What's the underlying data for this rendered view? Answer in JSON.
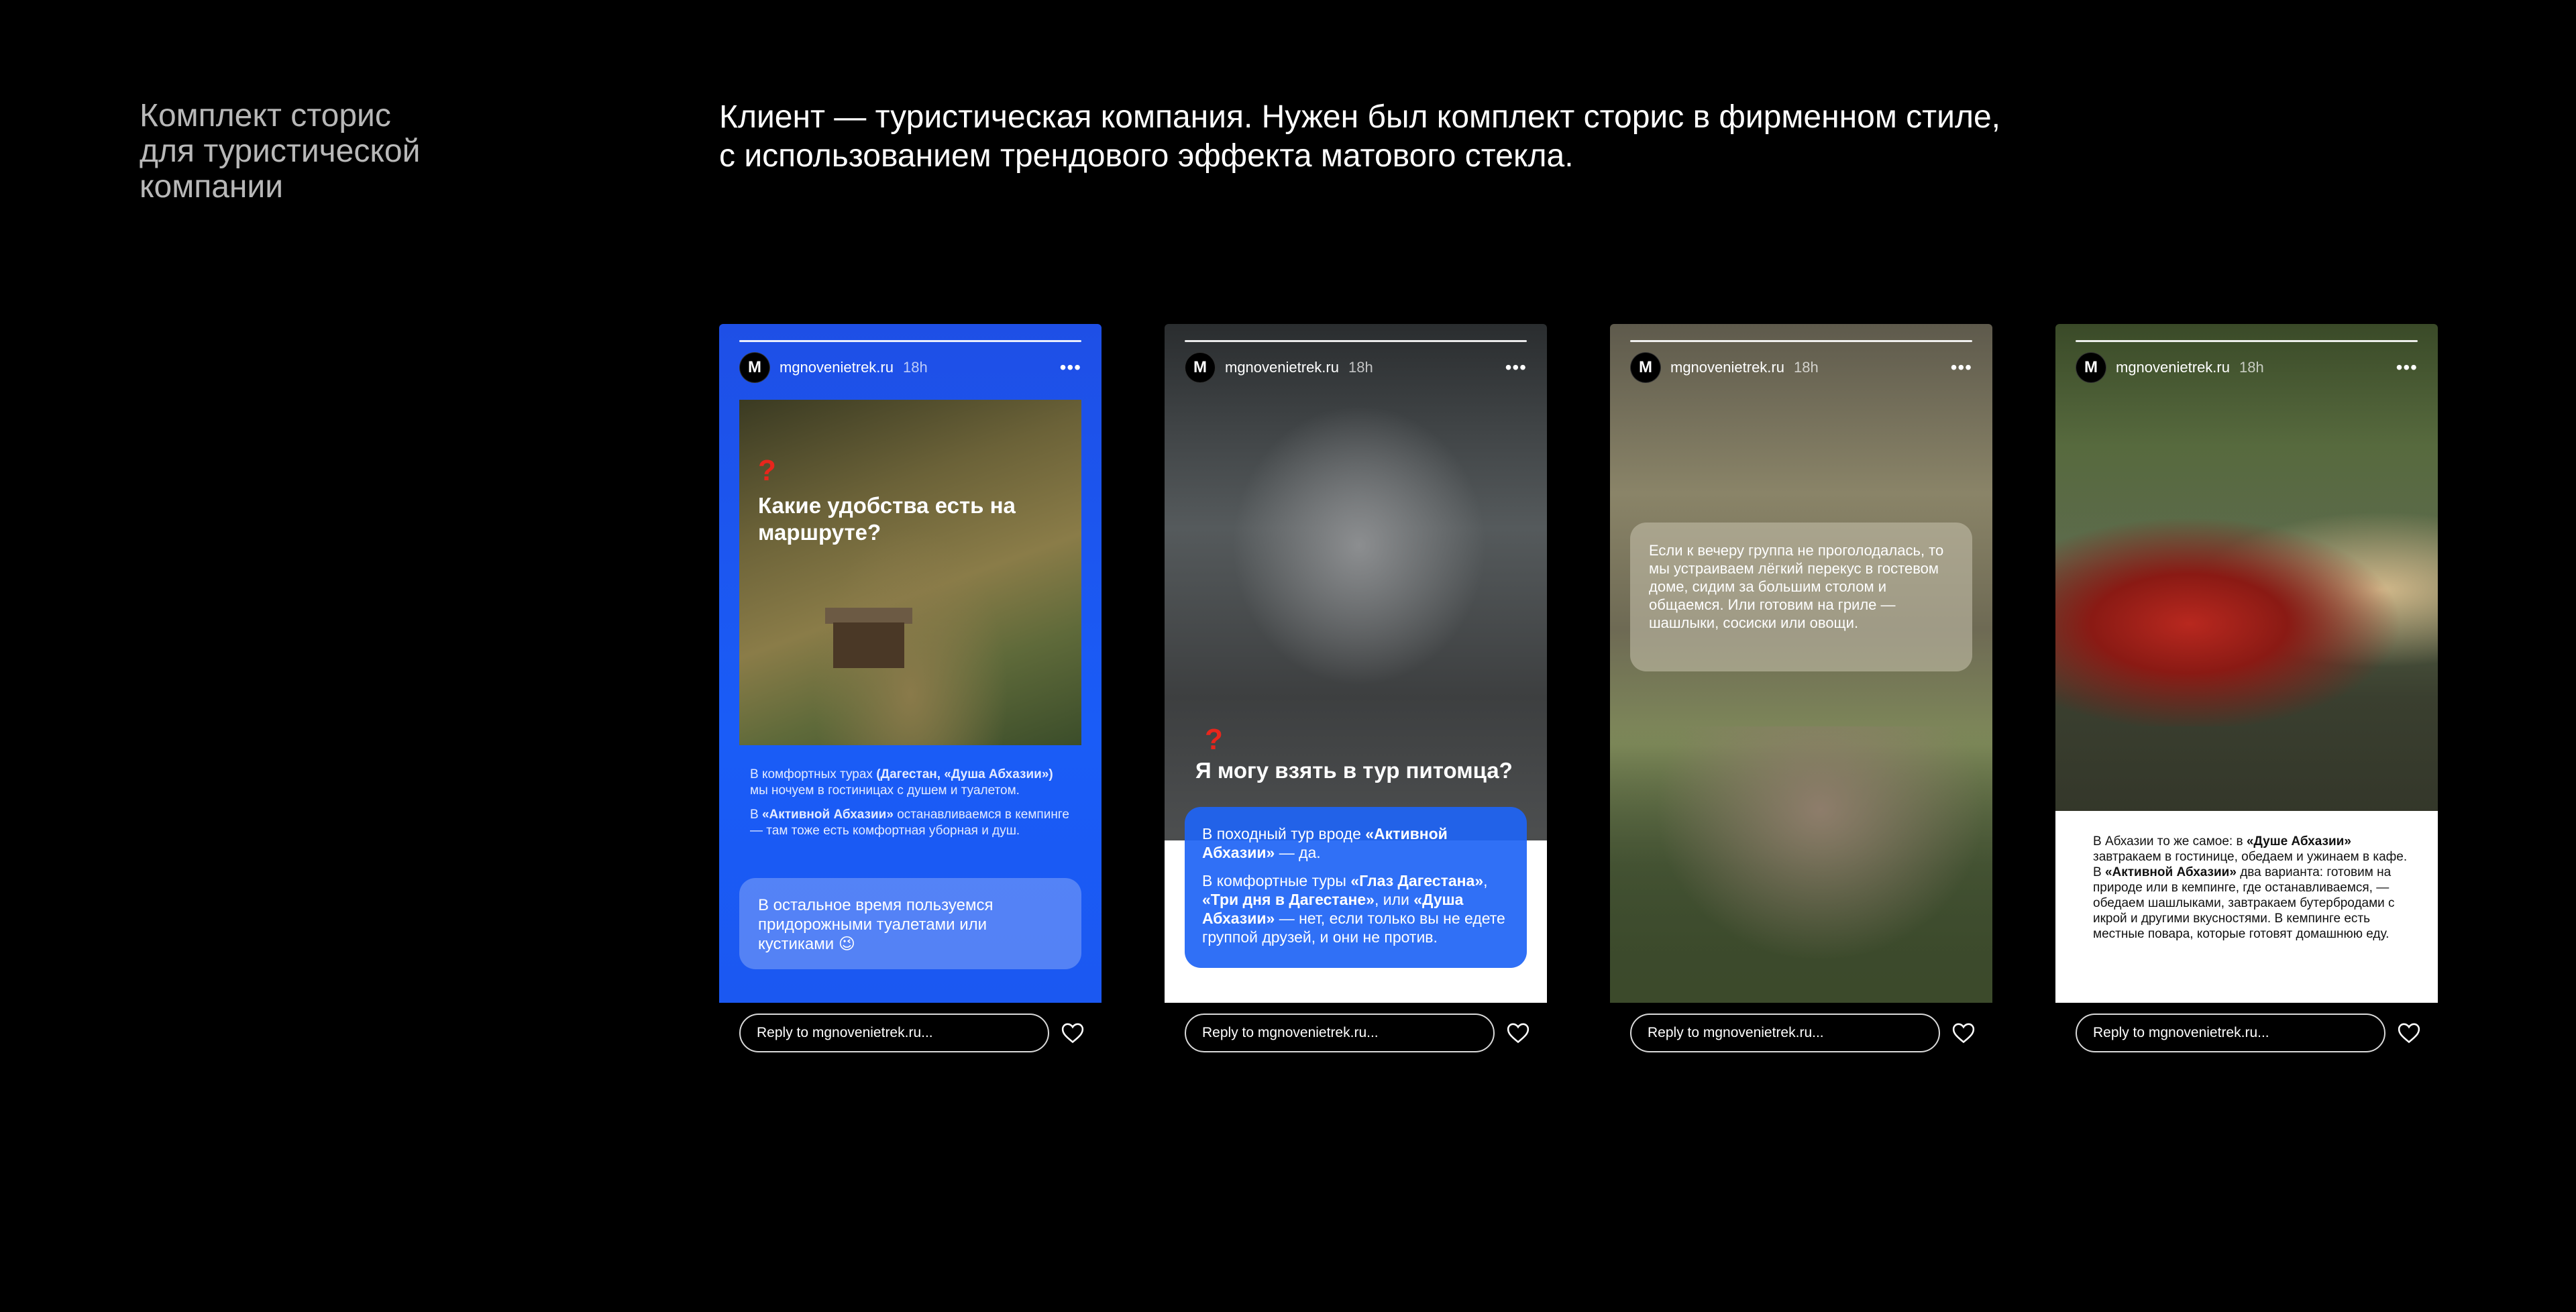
{
  "header": {
    "title": "Комплект сторис\nдля туристической\nкомпании",
    "description": "Клиент — туристическая компания. Нужен был комплект сторис в фирменном стиле,\nс использованием трендового эффекта матового стекла."
  },
  "story_common": {
    "avatar_letter": "M",
    "username": "mgnovenietrek.ru",
    "time": "18h",
    "more": "•••",
    "reply_placeholder": "Reply to mgnovenietrek.ru...",
    "question_mark": "?"
  },
  "stories": [
    {
      "photo_title": "Какие удобства есть на маршруте?",
      "para1_pre": "В комфортных турах ",
      "para1_bold": "(Дагестан, «Душа Абхазии»)",
      "para1_post": " мы ночуем в гостиницах с душем и туалетом.",
      "para2_pre": "В ",
      "para2_bold": "«Активной Абхазии»",
      "para2_post": " останавливаемся в кемпинге — там тоже есть комфортная уборная и душ.",
      "bubble": "В остальное время пользуемся придорожными туалетами или кустиками 😉"
    },
    {
      "title": "Я могу взять в тур питомца?",
      "p1_pre": "В походный тур вроде ",
      "p1_bold": "«Активной Абхазии»",
      "p1_post": " — да.",
      "p2_pre": "В комфортные туры ",
      "p2_bold1": "«Глаз Дагестана»",
      "p2_mid": ", ",
      "p2_bold2": "«Три дня в Дагестане»",
      "p2_mid2": ", или ",
      "p2_bold3": "«Душа Абхазии»",
      "p2_post": " — нет, если только вы не едете группой друзей, и они не против."
    },
    {
      "bubble": "Если к вечеру группа не проголодалась, то мы устраиваем лёгкий перекус в гостевом доме, сидим за большим столом и общаемся. Или готовим на гриле — шашлыки, сосиски или овощи."
    },
    {
      "t_pre": "В Абхазии то же самое: в ",
      "t_bold1": "«Душе Абхазии»",
      "t_mid": " завтракаем в гостинице, обедаем и ужинаем в кафе. В ",
      "t_bold2": "«Активной Абхазии»",
      "t_post": " два варианта: готовим на природе или в кемпинге, где останавливаемся, — обедаем шашлыками, завтракаем бутербродами с икрой и другими вкусностями. В кемпинге есть местные повара, которые готовят домашнюю еду."
    }
  ],
  "colors": {
    "brand_blue": "#1a5cf7",
    "accent_red": "#e8261c",
    "background": "#000000"
  }
}
